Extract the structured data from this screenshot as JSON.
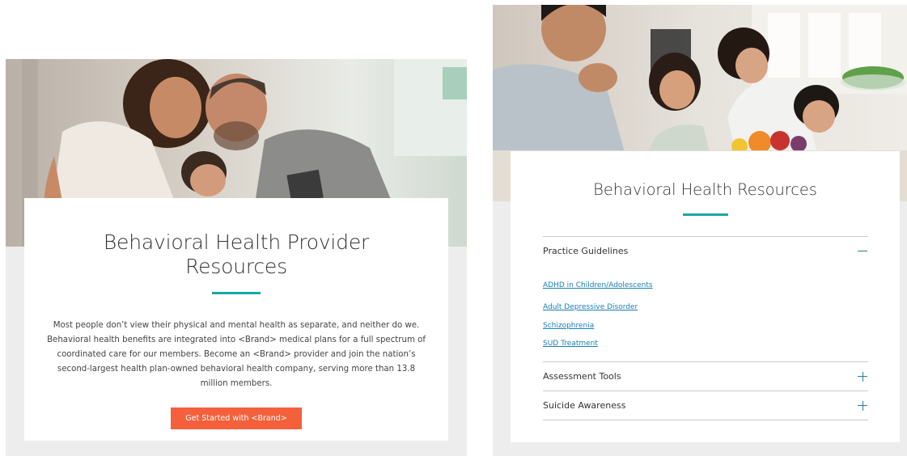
{
  "colors": {
    "accent_teal": "#1ba6a6",
    "cta_orange": "#f4603c",
    "link_blue": "#1a7fb5",
    "toggle_blue": "#2a7a9c",
    "panel_gray": "#ededed"
  },
  "provider_card": {
    "hero_image_alt": "family-hero-photo",
    "title": "Behavioral Health Provider Resources",
    "description": "Most people don’t view their physical and mental health as separate, and neither do we. Behavioral health benefits are integrated into <Brand> medical plans for a full spectrum of coordinated care for our members. Become an <Brand> provider and join the nation’s second-largest health plan-owned behavioral health company, serving more than 13.8 million members.",
    "cta_label": "Get Started with <Brand>"
  },
  "resources_card": {
    "title": "Behavioral Health Resources",
    "sections": [
      {
        "title": "Practice Guidelines",
        "expanded": true,
        "links": [
          "ADHD in Children/Adolescents",
          "Adult Depressive Disorder",
          "Schizophrenia",
          "SUD Treatment"
        ]
      },
      {
        "title": "Assessment Tools",
        "expanded": false
      },
      {
        "title": "Suicide Awareness",
        "expanded": false
      }
    ]
  }
}
